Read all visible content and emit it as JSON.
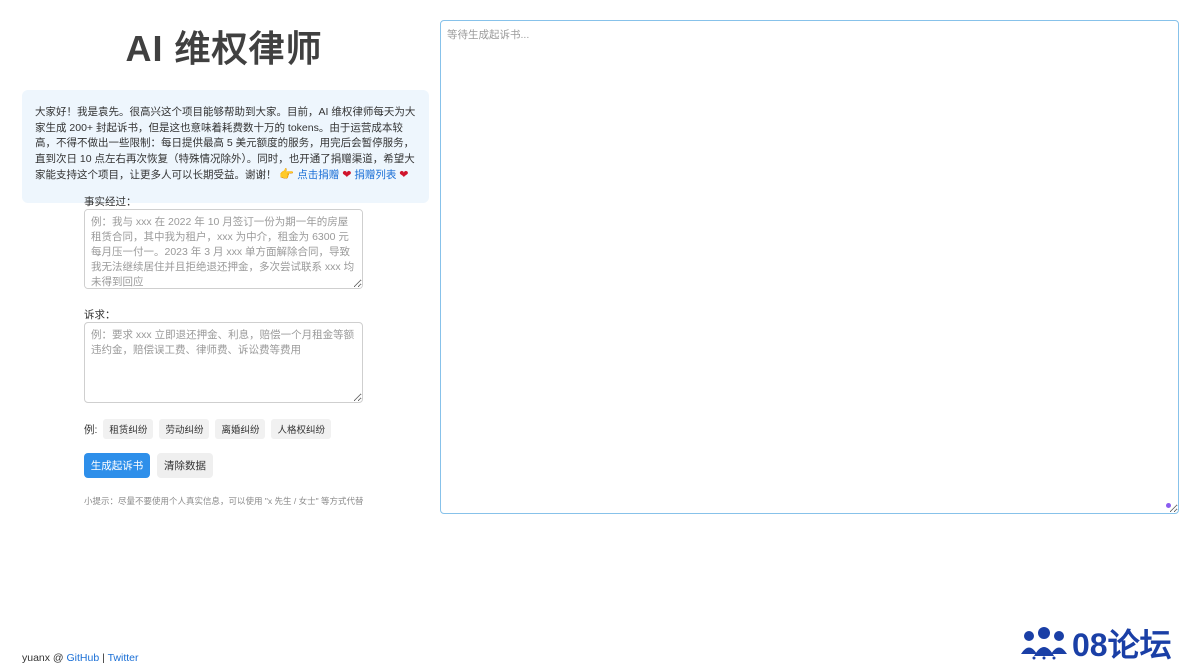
{
  "page": {
    "title": "AI 维权律师"
  },
  "notice": {
    "text": "大家好！我是袁先。很高兴这个项目能够帮助到大家。目前，AI 维权律师每天为大家生成 200+ 封起诉书，但是这也意味着耗费数十万的 tokens。由于运营成本较高，不得不做出一些限制：每日提供最高 5 美元额度的服务，用完后会暂停服务，直到次日 10 点左右再次恢复（特殊情况除外）。同时，也开通了捐赠渠道，希望大家能支持这个项目，让更多人可以长期受益。谢谢！",
    "donate_link": "点击捐赠",
    "donors_link": "捐赠列表"
  },
  "form": {
    "facts_label": "事实经过：",
    "facts_placeholder": "例：我与 xxx 在 2022 年 10 月签订一份为期一年的房屋租赁合同，其中我为租户，xxx 为中介，租金为 6300 元每月压一付一。2023 年 3 月 xxx 单方面解除合同，导致我无法继续居住并且拒绝退还押金，多次尝试联系 xxx 均未得到回应",
    "claims_label": "诉求：",
    "claims_placeholder": "例：要求 xxx 立即退还押金、利息，赔偿一个月租金等额违约金，赔偿误工费、律师费、诉讼费等费用",
    "examples_label": "例:",
    "examples": [
      "租赁纠纷",
      "劳动纠纷",
      "离婚纠纷",
      "人格权纠纷"
    ],
    "generate_button": "生成起诉书",
    "clear_button": "清除数据",
    "tip": "小提示：尽量不要使用个人真实信息，可以使用 \"x 先生 / 女士\" 等方式代替"
  },
  "output": {
    "placeholder": "等待生成起诉书..."
  },
  "footer": {
    "author": "yuanx @ ",
    "github": "GitHub",
    "separator": " | ",
    "twitter": "Twitter"
  },
  "watermark": {
    "text": "08论坛",
    "icon": "people-group-icon"
  }
}
